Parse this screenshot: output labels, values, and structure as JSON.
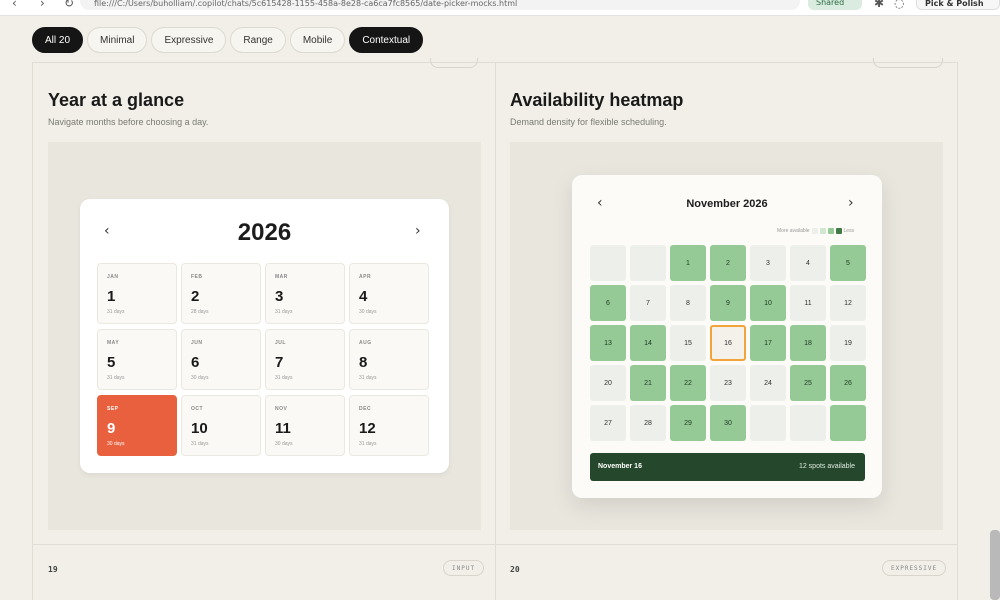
{
  "browser": {
    "url": "file:///C:/Users/buholliam/.copilot/chats/5c615428-1155-458a-8e28-ca6ca7fc8565/date-picker-mocks.html",
    "shared_label": "Shared",
    "pick_label": "Pick & Polish"
  },
  "filters": [
    {
      "label": "All 20",
      "active": true
    },
    {
      "label": "Minimal",
      "active": false
    },
    {
      "label": "Expressive",
      "active": false
    },
    {
      "label": "Range",
      "active": false
    },
    {
      "label": "Mobile",
      "active": false
    },
    {
      "label": "Contextual",
      "active": true
    }
  ],
  "card_left": {
    "title": "Year at a glance",
    "subtitle": "Navigate months before choosing a day.",
    "year": "2026",
    "prev_icon": "chevron-left-icon",
    "next_icon": "chevron-right-icon",
    "selected_month": "SEP",
    "months": [
      {
        "abbr": "JAN",
        "num": "1",
        "days": "31 days"
      },
      {
        "abbr": "FEB",
        "num": "2",
        "days": "28 days"
      },
      {
        "abbr": "MAR",
        "num": "3",
        "days": "31 days"
      },
      {
        "abbr": "APR",
        "num": "4",
        "days": "30 days"
      },
      {
        "abbr": "MAY",
        "num": "5",
        "days": "31 days"
      },
      {
        "abbr": "JUN",
        "num": "6",
        "days": "30 days"
      },
      {
        "abbr": "JUL",
        "num": "7",
        "days": "31 days"
      },
      {
        "abbr": "AUG",
        "num": "8",
        "days": "31 days"
      },
      {
        "abbr": "SEP",
        "num": "9",
        "days": "30 days"
      },
      {
        "abbr": "OCT",
        "num": "10",
        "days": "31 days"
      },
      {
        "abbr": "NOV",
        "num": "11",
        "days": "30 days"
      },
      {
        "abbr": "DEC",
        "num": "12",
        "days": "31 days"
      }
    ],
    "index": "19",
    "tag": "INPUT"
  },
  "card_right": {
    "title": "Availability heatmap",
    "subtitle": "Demand density for flexible scheduling.",
    "month_label": "November 2026",
    "legend_more": "More available",
    "legend_less": "Less",
    "legend_colors": [
      "#ecefea",
      "#d2e7d0",
      "#95c995",
      "#3f7a48"
    ],
    "selected_day": "16",
    "days": [
      {
        "n": "",
        "level": 1
      },
      {
        "n": "",
        "level": 1
      },
      {
        "n": "1",
        "level": 3
      },
      {
        "n": "2",
        "level": 3
      },
      {
        "n": "3",
        "level": 1
      },
      {
        "n": "4",
        "level": 1
      },
      {
        "n": "5",
        "level": 3
      },
      {
        "n": "6",
        "level": 3
      },
      {
        "n": "7",
        "level": 1
      },
      {
        "n": "8",
        "level": 1
      },
      {
        "n": "9",
        "level": 3
      },
      {
        "n": "10",
        "level": 3
      },
      {
        "n": "11",
        "level": 1
      },
      {
        "n": "12",
        "level": 1
      },
      {
        "n": "13",
        "level": 3
      },
      {
        "n": "14",
        "level": 3
      },
      {
        "n": "15",
        "level": 1
      },
      {
        "n": "16",
        "level": 1
      },
      {
        "n": "17",
        "level": 3
      },
      {
        "n": "18",
        "level": 3
      },
      {
        "n": "19",
        "level": 1
      },
      {
        "n": "20",
        "level": 1
      },
      {
        "n": "21",
        "level": 3
      },
      {
        "n": "22",
        "level": 3
      },
      {
        "n": "23",
        "level": 1
      },
      {
        "n": "24",
        "level": 1
      },
      {
        "n": "25",
        "level": 3
      },
      {
        "n": "26",
        "level": 3
      },
      {
        "n": "27",
        "level": 1
      },
      {
        "n": "28",
        "level": 1
      },
      {
        "n": "29",
        "level": 3
      },
      {
        "n": "30",
        "level": 3
      },
      {
        "n": "",
        "level": 1
      },
      {
        "n": "",
        "level": 1
      },
      {
        "n": "",
        "level": 3
      }
    ],
    "footer_date": "November 16",
    "footer_spots": "12 spots available",
    "index": "20",
    "tag": "EXPRESSIVE"
  },
  "colors": {
    "accent_orange": "#e8603e",
    "heat_dark": "#25482c",
    "today_ring": "#f0a43a"
  }
}
